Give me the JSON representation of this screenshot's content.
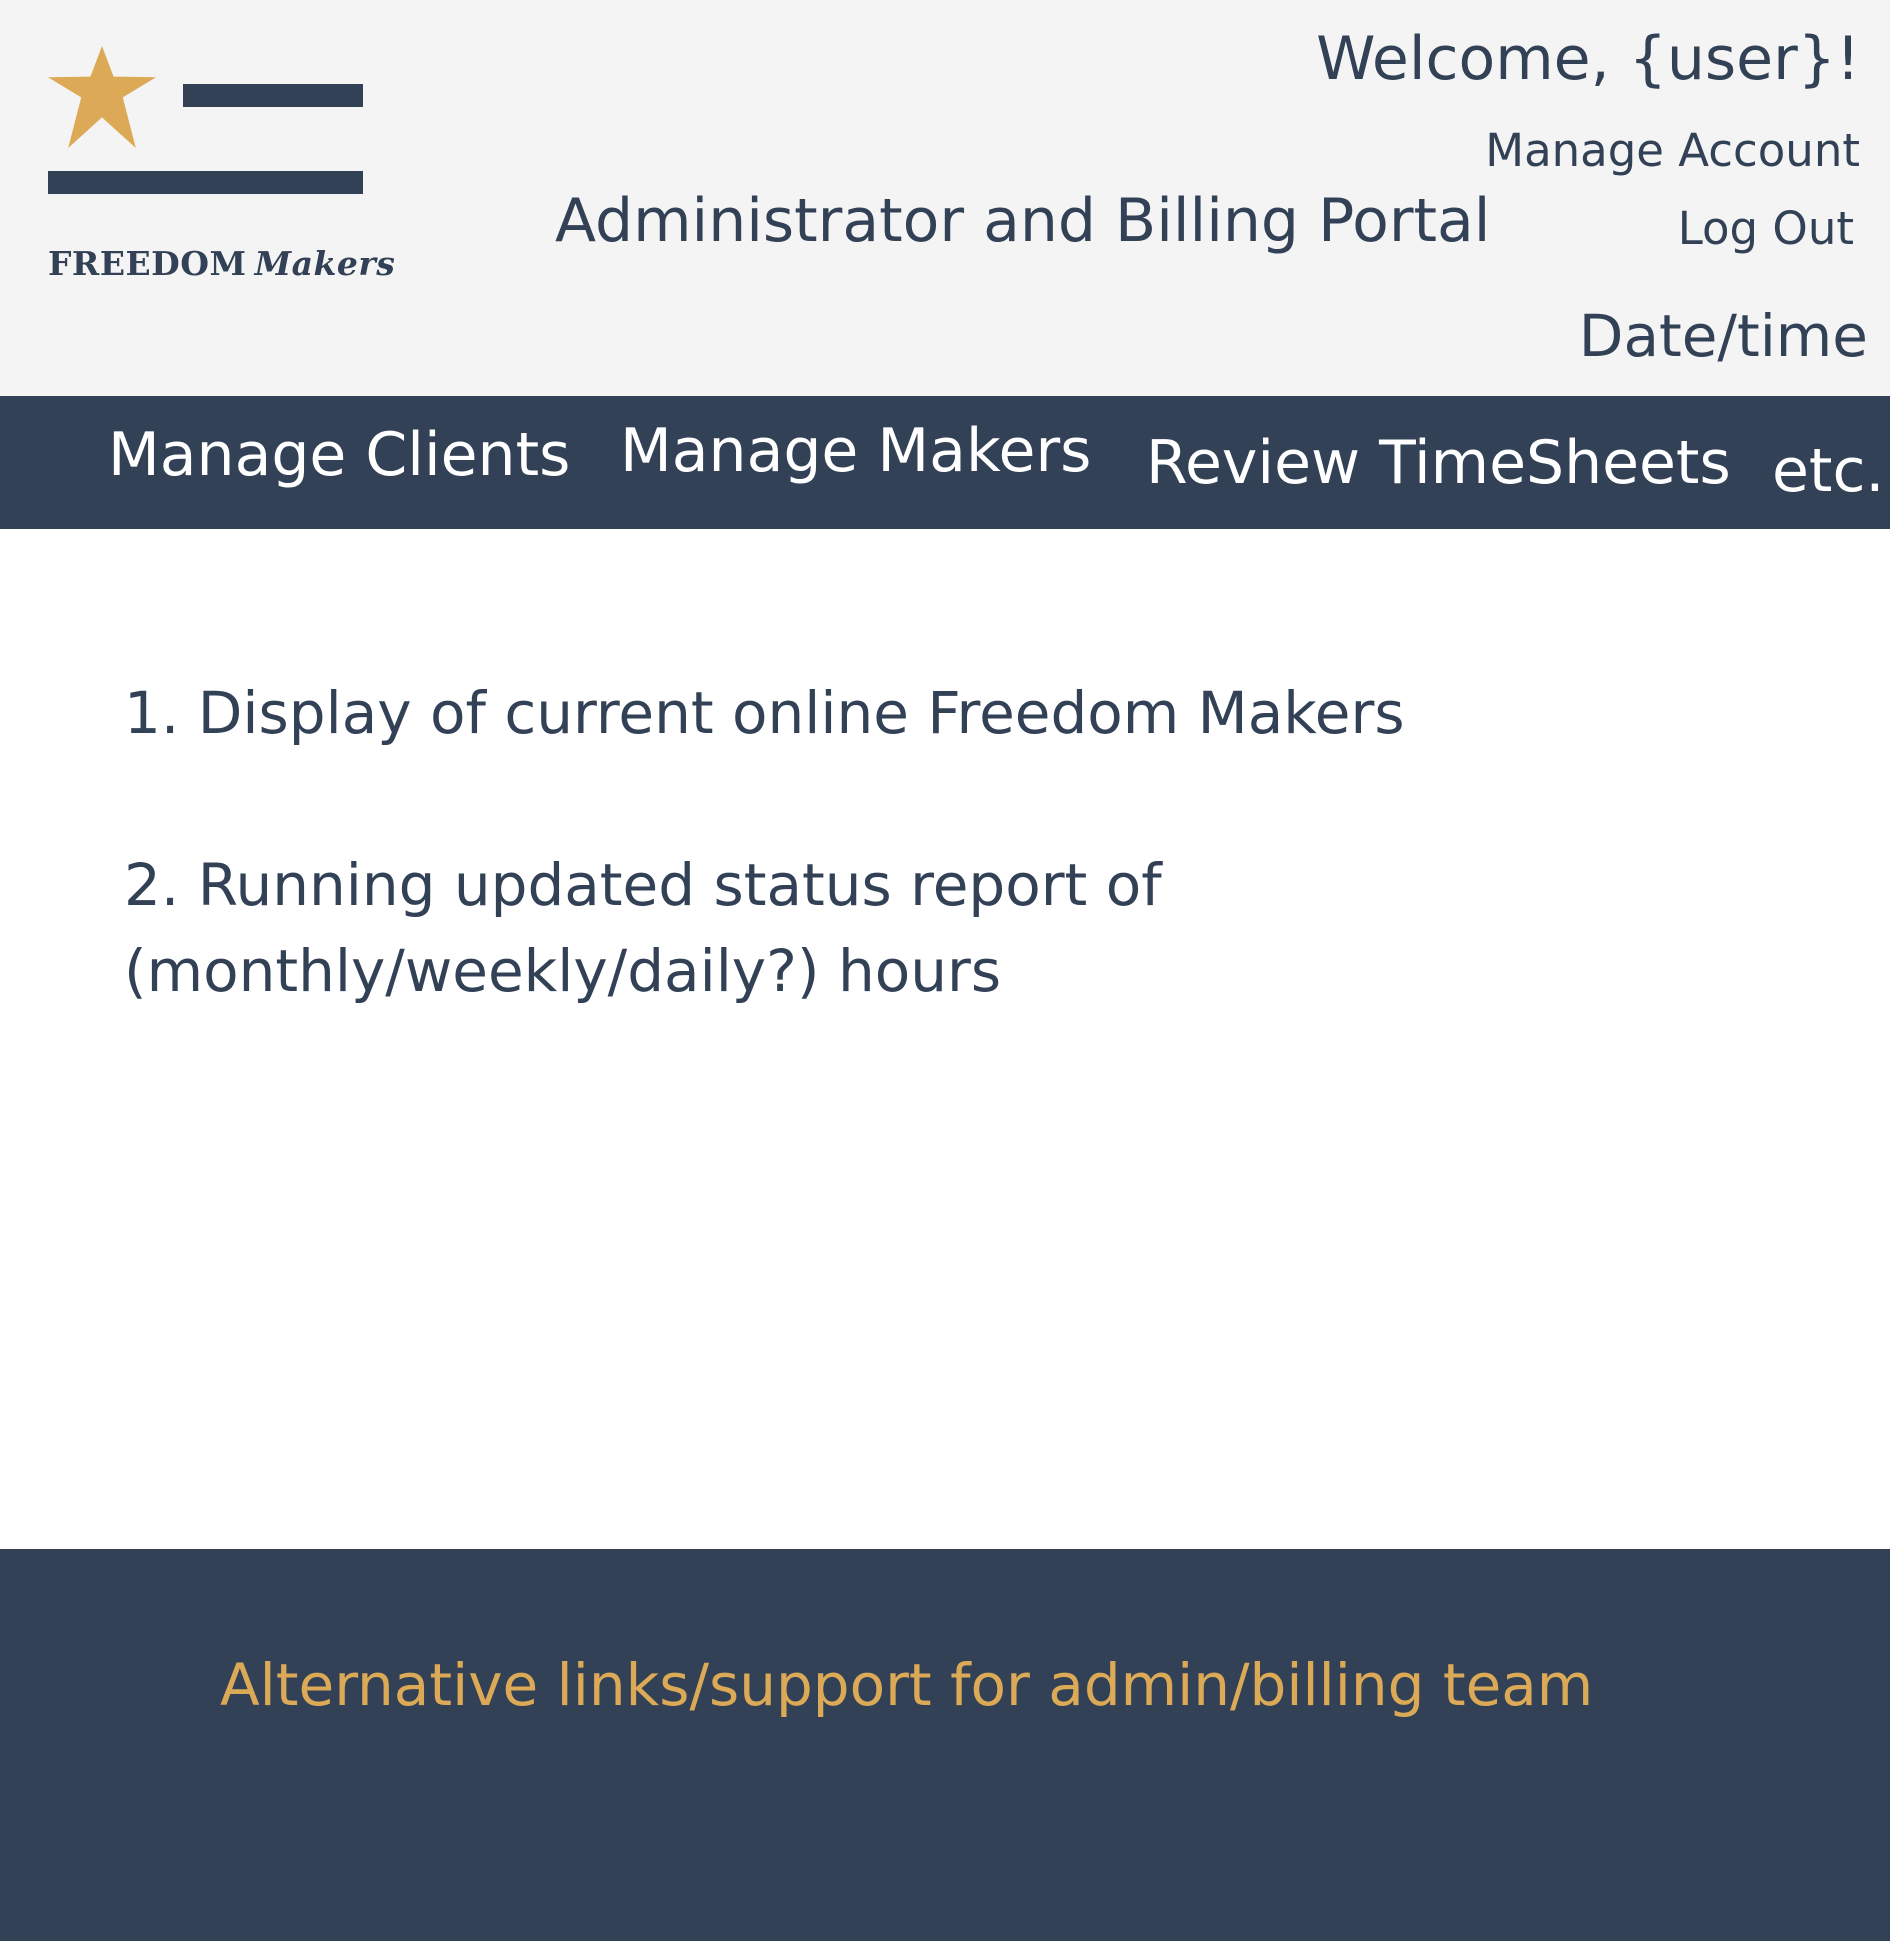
{
  "colors": {
    "header_bg": "#f4f4f4",
    "navy": "#324156",
    "gold": "#dcaa57",
    "white": "#ffffff"
  },
  "header": {
    "brand": {
      "name_main": "FREEDOM",
      "name_accent": "Makers",
      "icon": "star-flag-logo"
    },
    "portal_title": "Administrator and Billing Portal",
    "welcome": "Welcome, {user}!",
    "manage_account": "Manage Account",
    "logout": "Log Out",
    "datetime": "Date/time"
  },
  "nav": {
    "items": [
      {
        "label": "Manage Clients"
      },
      {
        "label": "Manage Makers"
      },
      {
        "label": "Review TimeSheets"
      },
      {
        "label": "etc."
      }
    ]
  },
  "main": {
    "items": [
      {
        "text": "1. Display of current online Freedom Makers"
      },
      {
        "text": "2. Running updated status report of (monthly/weekly/daily?) hours"
      }
    ]
  },
  "footer": {
    "text": "Alternative links/support for admin/billing team"
  }
}
